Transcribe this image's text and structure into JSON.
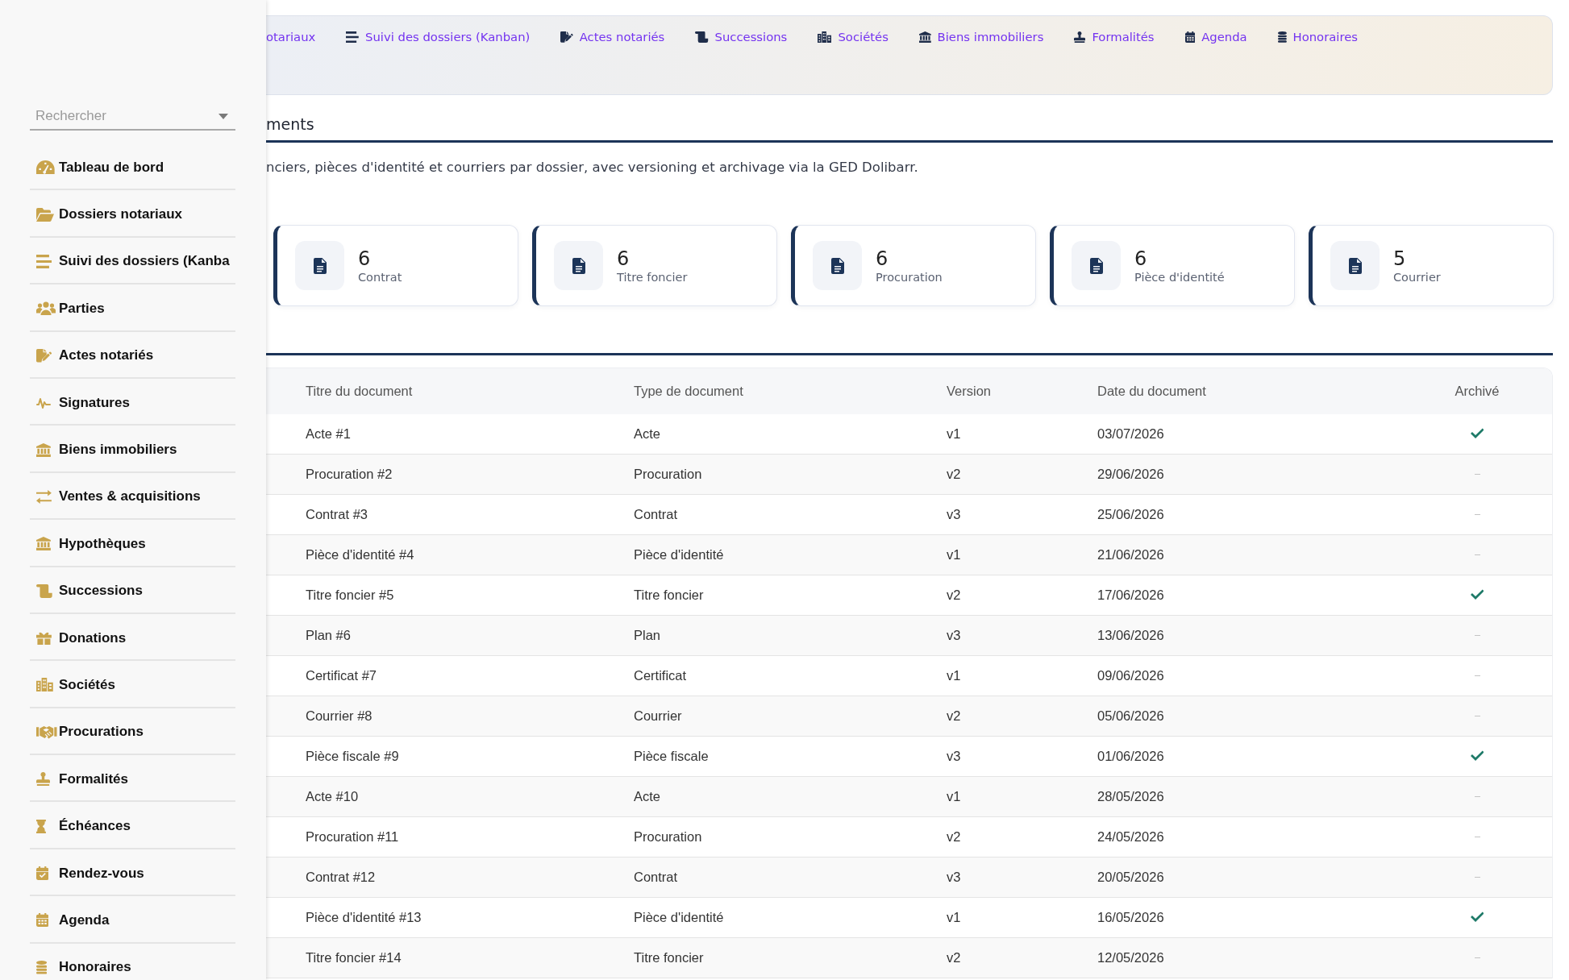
{
  "sidebar": {
    "search": {
      "placeholder": "Rechercher"
    },
    "items": [
      "Tableau de bord",
      "Dossiers notariaux",
      "Suivi des dossiers (Kanba",
      "Parties",
      "Actes notariés",
      "Signatures",
      "Biens immobiliers",
      "Ventes & acquisitions",
      "Hypothèques",
      "Successions",
      "Donations",
      "Sociétés",
      "Procurations",
      "Formalités",
      "Échéances",
      "Rendez-vous",
      "Agenda",
      "Honoraires"
    ]
  },
  "nav": {
    "links": [
      "otariaux",
      "Suivi des dossiers (Kanban)",
      "Actes notariés",
      "Successions",
      "Sociétés",
      "Biens immobiliers",
      "Formalités",
      "Agenda",
      "Honoraires"
    ]
  },
  "page": {
    "title": "ments",
    "description": "nciers, pièces d'identité et courriers par dossier, avec versioning et archivage via la GED Dolibarr."
  },
  "stats": [
    {
      "value": "6",
      "label": "Contrat"
    },
    {
      "value": "6",
      "label": "Titre foncier"
    },
    {
      "value": "6",
      "label": "Procuration"
    },
    {
      "value": "6",
      "label": "Pièce d'identité"
    },
    {
      "value": "5",
      "label": "Courrier"
    }
  ],
  "table": {
    "columns": [
      "Titre du document",
      "Type de document",
      "Version",
      "Date du document",
      "Archivé"
    ],
    "rows": [
      {
        "title": "Acte #1",
        "type": "Acte",
        "version": "v1",
        "date": "03/07/2026",
        "archived": true
      },
      {
        "title": "Procuration #2",
        "type": "Procuration",
        "version": "v2",
        "date": "29/06/2026",
        "archived": false
      },
      {
        "title": "Contrat #3",
        "type": "Contrat",
        "version": "v3",
        "date": "25/06/2026",
        "archived": false
      },
      {
        "title": "Pièce d'identité #4",
        "type": "Pièce d'identité",
        "version": "v1",
        "date": "21/06/2026",
        "archived": false
      },
      {
        "title": "Titre foncier #5",
        "type": "Titre foncier",
        "version": "v2",
        "date": "17/06/2026",
        "archived": true
      },
      {
        "title": "Plan #6",
        "type": "Plan",
        "version": "v3",
        "date": "13/06/2026",
        "archived": false
      },
      {
        "title": "Certificat #7",
        "type": "Certificat",
        "version": "v1",
        "date": "09/06/2026",
        "archived": false
      },
      {
        "title": "Courrier #8",
        "type": "Courrier",
        "version": "v2",
        "date": "05/06/2026",
        "archived": false
      },
      {
        "title": "Pièce fiscale #9",
        "type": "Pièce fiscale",
        "version": "v3",
        "date": "01/06/2026",
        "archived": true
      },
      {
        "title": "Acte #10",
        "type": "Acte",
        "version": "v1",
        "date": "28/05/2026",
        "archived": false
      },
      {
        "title": "Procuration #11",
        "type": "Procuration",
        "version": "v2",
        "date": "24/05/2026",
        "archived": false
      },
      {
        "title": "Contrat #12",
        "type": "Contrat",
        "version": "v3",
        "date": "20/05/2026",
        "archived": false
      },
      {
        "title": "Pièce d'identité #13",
        "type": "Pièce d'identité",
        "version": "v1",
        "date": "16/05/2026",
        "archived": true
      },
      {
        "title": "Titre foncier #14",
        "type": "Titre foncier",
        "version": "v2",
        "date": "12/05/2026",
        "archived": false
      }
    ]
  }
}
